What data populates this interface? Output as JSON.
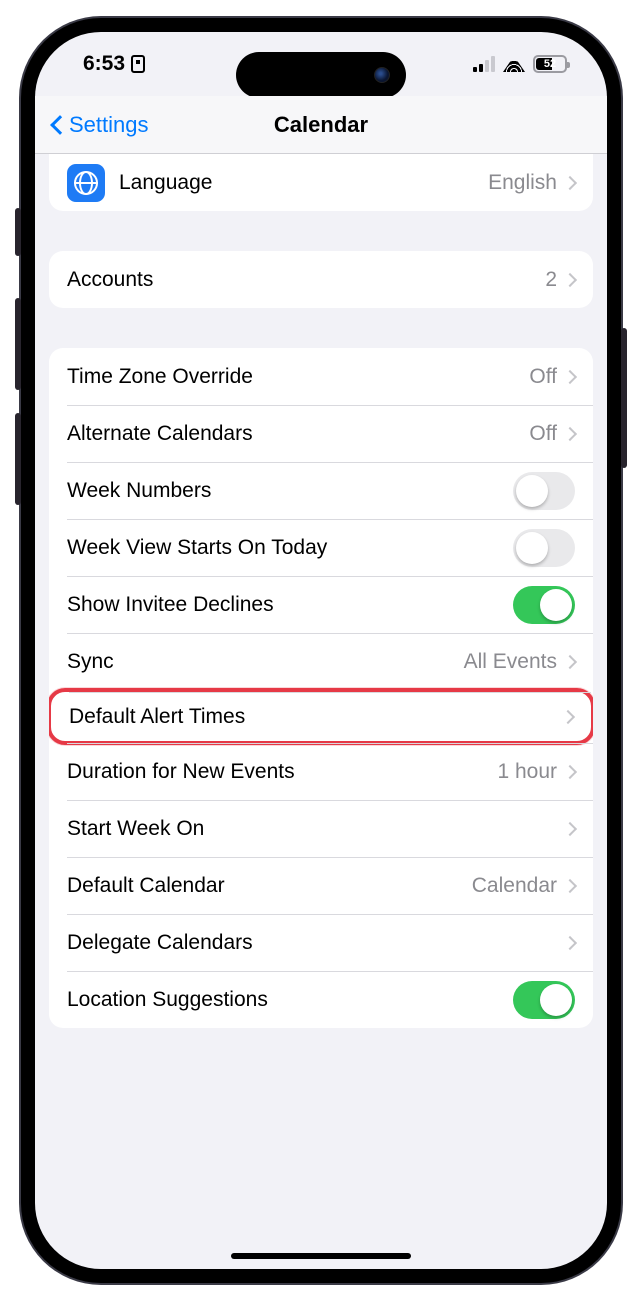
{
  "status": {
    "time": "6:53",
    "battery_pct": "52"
  },
  "nav": {
    "back_label": "Settings",
    "title": "Calendar"
  },
  "group1": {
    "language_label": "Language",
    "language_value": "English"
  },
  "group2": {
    "accounts_label": "Accounts",
    "accounts_value": "2"
  },
  "group3": {
    "tz_override_label": "Time Zone Override",
    "tz_override_value": "Off",
    "alt_cal_label": "Alternate Calendars",
    "alt_cal_value": "Off",
    "week_numbers_label": "Week Numbers",
    "week_numbers_on": false,
    "week_view_label": "Week View Starts On Today",
    "week_view_on": false,
    "show_invitee_label": "Show Invitee Declines",
    "show_invitee_on": true,
    "sync_label": "Sync",
    "sync_value": "All Events",
    "default_alert_label": "Default Alert Times",
    "duration_label": "Duration for New Events",
    "duration_value": "1 hour",
    "start_week_label": "Start Week On",
    "default_cal_label": "Default Calendar",
    "default_cal_value": "Calendar",
    "delegate_label": "Delegate Calendars",
    "location_sugg_label": "Location Suggestions",
    "location_sugg_on": true
  }
}
